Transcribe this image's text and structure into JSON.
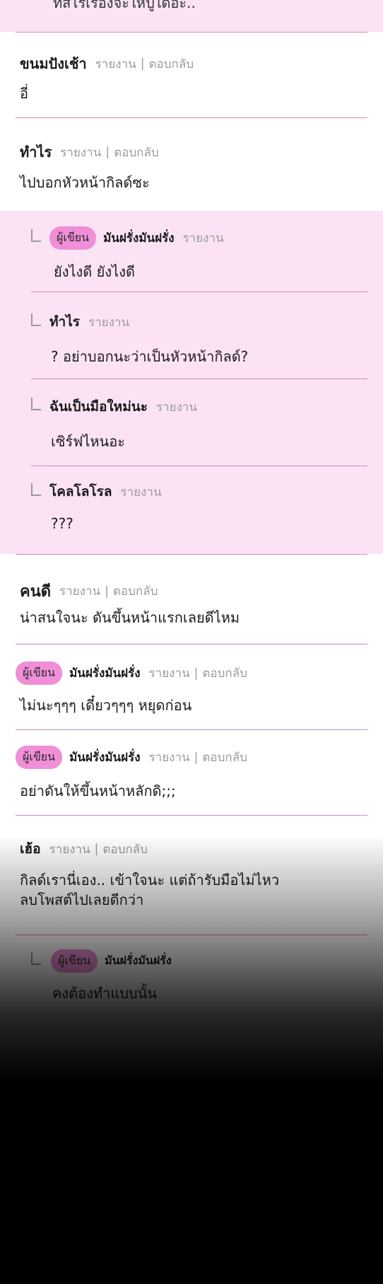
{
  "top_fragment": "ทิสไรเรื่องจะให้ปู้ใด้อะ..",
  "actions": {
    "report": "รายงาน",
    "sep": "|",
    "reply": "ตอบกลับ"
  },
  "author_badge": "ผู้เขียน",
  "comments": [
    {
      "name": "ขนมปังเช้า",
      "text": "อี่"
    },
    {
      "name": "ทำไร",
      "text": "ไปบอกหัวหน้ากิลด์ซะ"
    },
    {
      "name": "คนดี",
      "text": "น่าสนใจนะ ดันขึ้นหน้าแรกเลยดีไหม"
    },
    {
      "name": "มันฝรั่งมันฝรั่ง",
      "text": "ไม่นะๆๆๆ เดี๋ยวๆๆๆ หยุดก่อน"
    },
    {
      "name": "มันฝรั่งมันฝรั่ง",
      "text": "อย่าดันให้ขึ้นหน้าหลักดิ;;;"
    },
    {
      "name": "เฮ้อ",
      "text_line1": "กิลด์เรานี่เอง.. เข้าใจนะ แต่ถ้ารับมือไม่ไหว",
      "text_line2": "ลบโพสต์ไปเลยดีกว่า"
    }
  ],
  "replies": [
    {
      "name": "มันฝรั่งมันฝรั่ง",
      "text": "ยังไงดี ยังไงดี"
    },
    {
      "name": "ทำไร",
      "text": "? อย่าบอกนะว่าเป็นหัวหน้ากิลด์?"
    },
    {
      "name": "ฉันเป็นมือใหม่นะ",
      "text": "เซิร์ฟไหนอะ"
    },
    {
      "name": "โคลโลโรล",
      "text": "???"
    },
    {
      "name": "มันฝรั่งมันฝรั่ง",
      "text": "คงต้องทำแบบนั้น"
    }
  ]
}
